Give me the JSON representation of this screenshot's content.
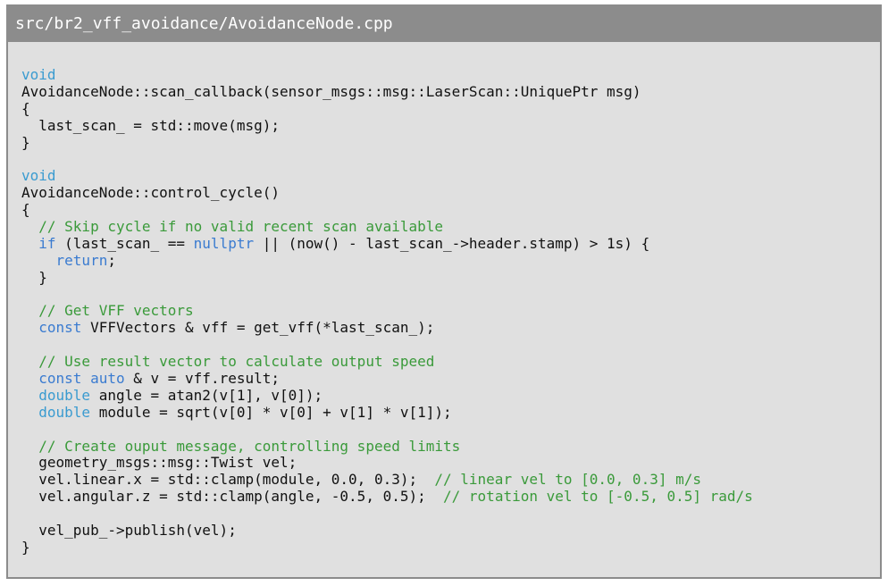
{
  "listing": {
    "filename": "src/br2_vff_avoidance/AvoidanceNode.cpp",
    "colors": {
      "background": "#e0e0e0",
      "header": "#8c8c8c",
      "keyword": "#3a7bd0",
      "type": "#3a9bd0",
      "comment": "#3a9a3a",
      "text": "#111111"
    },
    "lines": [
      [
        {
          "t": "void",
          "c": "ty"
        }
      ],
      [
        {
          "t": "AvoidanceNode::scan_callback(sensor_msgs::msg::LaserScan::UniquePtr msg)",
          "c": "pl"
        }
      ],
      [
        {
          "t": "{",
          "c": "pl"
        }
      ],
      [
        {
          "t": "  last_scan_ = std::move(msg);",
          "c": "pl"
        }
      ],
      [
        {
          "t": "}",
          "c": "pl"
        }
      ],
      [],
      [
        {
          "t": "void",
          "c": "ty"
        }
      ],
      [
        {
          "t": "AvoidanceNode::control_cycle()",
          "c": "pl"
        }
      ],
      [
        {
          "t": "{",
          "c": "pl"
        }
      ],
      [
        {
          "t": "  // Skip cycle if no valid recent scan available",
          "c": "cm"
        }
      ],
      [
        {
          "t": "  ",
          "c": "pl"
        },
        {
          "t": "if",
          "c": "kw"
        },
        {
          "t": " (last_scan_ == ",
          "c": "pl"
        },
        {
          "t": "nullptr",
          "c": "kw"
        },
        {
          "t": " || (now() - last_scan_->header.stamp) > 1s) {",
          "c": "pl"
        }
      ],
      [
        {
          "t": "    ",
          "c": "pl"
        },
        {
          "t": "return",
          "c": "kw"
        },
        {
          "t": ";",
          "c": "pl"
        }
      ],
      [
        {
          "t": "  }",
          "c": "pl"
        }
      ],
      [],
      [
        {
          "t": "  // Get VFF vectors",
          "c": "cm"
        }
      ],
      [
        {
          "t": "  ",
          "c": "pl"
        },
        {
          "t": "const",
          "c": "kw"
        },
        {
          "t": " VFFVectors & vff = get_vff(*last_scan_);",
          "c": "pl"
        }
      ],
      [],
      [
        {
          "t": "  // Use result vector to calculate output speed",
          "c": "cm"
        }
      ],
      [
        {
          "t": "  ",
          "c": "pl"
        },
        {
          "t": "const",
          "c": "kw"
        },
        {
          "t": " ",
          "c": "pl"
        },
        {
          "t": "auto",
          "c": "kw"
        },
        {
          "t": " & v = vff.result;",
          "c": "pl"
        }
      ],
      [
        {
          "t": "  ",
          "c": "pl"
        },
        {
          "t": "double",
          "c": "ty"
        },
        {
          "t": " angle = atan2(v[1], v[0]);",
          "c": "pl"
        }
      ],
      [
        {
          "t": "  ",
          "c": "pl"
        },
        {
          "t": "double",
          "c": "ty"
        },
        {
          "t": " module = sqrt(v[0] * v[0] + v[1] * v[1]);",
          "c": "pl"
        }
      ],
      [],
      [
        {
          "t": "  // Create ouput message, controlling speed limits",
          "c": "cm"
        }
      ],
      [
        {
          "t": "  geometry_msgs::msg::Twist vel;",
          "c": "pl"
        }
      ],
      [
        {
          "t": "  vel.linear.x = std::clamp(module, 0.0, 0.3);  ",
          "c": "pl"
        },
        {
          "t": "// linear vel to [0.0, 0.3] m/s",
          "c": "cm"
        }
      ],
      [
        {
          "t": "  vel.angular.z = std::clamp(angle, -0.5, 0.5);  ",
          "c": "pl"
        },
        {
          "t": "// rotation vel to [-0.5, 0.5] rad/s",
          "c": "cm"
        }
      ],
      [],
      [
        {
          "t": "  vel_pub_->publish(vel);",
          "c": "pl"
        }
      ],
      [
        {
          "t": "}",
          "c": "pl"
        }
      ]
    ]
  }
}
